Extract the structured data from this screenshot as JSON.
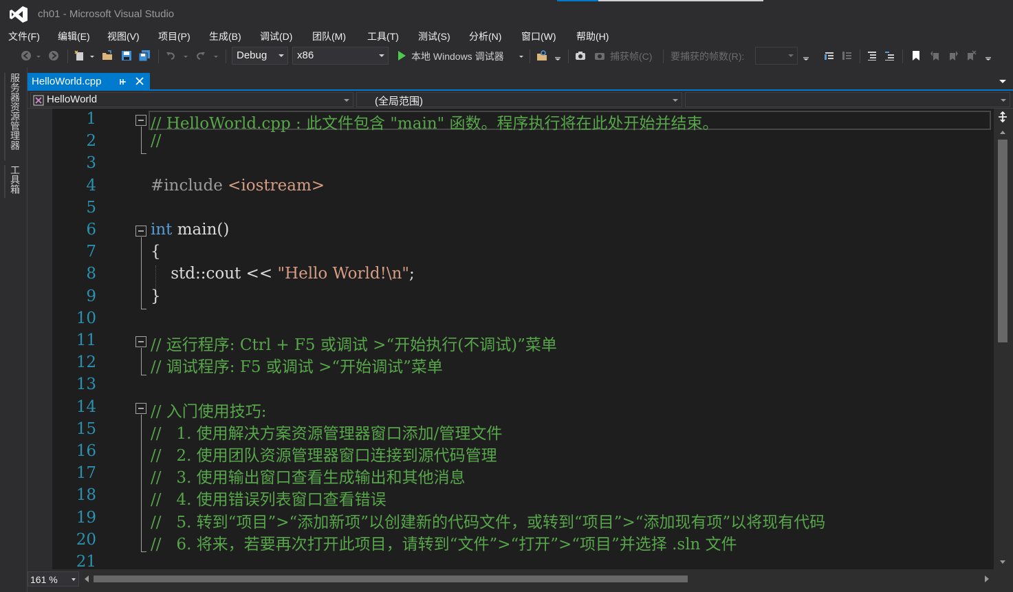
{
  "window": {
    "title": "ch01 - Microsoft Visual Studio"
  },
  "menu": [
    "文件(F)",
    "编辑(E)",
    "视图(V)",
    "项目(P)",
    "生成(B)",
    "调试(D)",
    "团队(M)",
    "工具(T)",
    "测试(S)",
    "分析(N)",
    "窗口(W)",
    "帮助(H)"
  ],
  "toolbar": {
    "configuration": "Debug",
    "platform": "x86",
    "debugger_label": "本地 Windows 调试器",
    "capture_frame": "捕获帧(C)",
    "frames_to_capture_label": "要捕获的帧数(R):",
    "frames_to_capture_value": ""
  },
  "side_panel": {
    "tabs": [
      "服务器资源管理器",
      "工具箱"
    ]
  },
  "doc_tab": {
    "file": "HelloWorld.cpp",
    "pin_icon": "pin-icon",
    "close_icon": "close-icon"
  },
  "navbar": {
    "project": "HelloWorld",
    "scope": "(全局范围)",
    "member": ""
  },
  "editor": {
    "lines": [
      {
        "n": "1",
        "segments": [
          {
            "t": "// HelloWorld.cpp : 此文件包含 \"main\" 函数。程序执行将在此处开始并结束。",
            "c": "comment"
          }
        ]
      },
      {
        "n": "2",
        "segments": [
          {
            "t": "//",
            "c": "comment"
          }
        ]
      },
      {
        "n": "3",
        "segments": []
      },
      {
        "n": "4",
        "segments": [
          {
            "t": "#include ",
            "c": "pre"
          },
          {
            "t": "<iostream>",
            "c": "str"
          }
        ]
      },
      {
        "n": "5",
        "segments": []
      },
      {
        "n": "6",
        "segments": [
          {
            "t": "int",
            "c": "kw"
          },
          {
            "t": " main()",
            "c": "plain"
          }
        ]
      },
      {
        "n": "7",
        "segments": [
          {
            "t": "{",
            "c": "plain"
          }
        ]
      },
      {
        "n": "8",
        "segments": [
          {
            "t": "    std::cout << ",
            "c": "plain"
          },
          {
            "t": "\"Hello World!\\n\"",
            "c": "str"
          },
          {
            "t": ";",
            "c": "plain"
          }
        ]
      },
      {
        "n": "9",
        "segments": [
          {
            "t": "}",
            "c": "plain"
          }
        ]
      },
      {
        "n": "10",
        "segments": []
      },
      {
        "n": "11",
        "segments": [
          {
            "t": "// 运行程序: Ctrl + F5 或调试 >“开始执行(不调试)”菜单",
            "c": "comment"
          }
        ]
      },
      {
        "n": "12",
        "segments": [
          {
            "t": "// 调试程序: F5 或调试 >“开始调试”菜单",
            "c": "comment"
          }
        ]
      },
      {
        "n": "13",
        "segments": []
      },
      {
        "n": "14",
        "segments": [
          {
            "t": "// 入门使用技巧: ",
            "c": "comment"
          }
        ]
      },
      {
        "n": "15",
        "segments": [
          {
            "t": "//   1. 使用解决方案资源管理器窗口添加/管理文件",
            "c": "comment"
          }
        ]
      },
      {
        "n": "16",
        "segments": [
          {
            "t": "//   2. 使用团队资源管理器窗口连接到源代码管理",
            "c": "comment"
          }
        ]
      },
      {
        "n": "17",
        "segments": [
          {
            "t": "//   3. 使用输出窗口查看生成输出和其他消息",
            "c": "comment"
          }
        ]
      },
      {
        "n": "18",
        "segments": [
          {
            "t": "//   4. 使用错误列表窗口查看错误",
            "c": "comment"
          }
        ]
      },
      {
        "n": "19",
        "segments": [
          {
            "t": "//   5. 转到“项目”>“添加新项”以创建新的代码文件，或转到“项目”>“添加现有项”以将现有代码",
            "c": "comment"
          }
        ]
      },
      {
        "n": "20",
        "segments": [
          {
            "t": "//   6. 将来，若要再次打开此项目，请转到“文件”>“打开”>“项目”并选择 .sln 文件",
            "c": "comment"
          }
        ]
      },
      {
        "n": "21",
        "segments": []
      }
    ]
  },
  "status": {
    "zoom": "161 %"
  },
  "colors": {
    "accent": "#007acc",
    "comment": "#57a64a",
    "keyword": "#569cd6",
    "string": "#d69d85",
    "line_number": "#2b91af"
  }
}
